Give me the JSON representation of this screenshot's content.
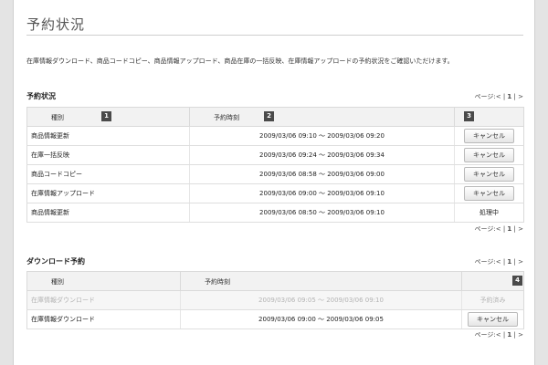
{
  "page": {
    "title": "予約状況",
    "intro": "在庫情報ダウンロード、商品コードコピー、商品情報アップロード、商品在庫の一括反映、在庫情報アップロードの予約状況をご確認いただけます。"
  },
  "reservations": {
    "title": "予約状況",
    "pager_top": {
      "label": "ページ:",
      "prev": "<",
      "current": "1",
      "next": ">"
    },
    "pager_bottom": {
      "label": "ページ:",
      "prev": "<",
      "current": "1",
      "next": ">"
    },
    "columns": {
      "type": "種別",
      "time": "予約時刻",
      "action": ""
    },
    "badges": {
      "b1": "1",
      "b2": "2",
      "b3": "3"
    },
    "rows": [
      {
        "type": "商品情報更新",
        "time": "2009/03/06 09:10 〜 2009/03/06 09:20",
        "action": "キャンセル"
      },
      {
        "type": "在庫一括反映",
        "time": "2009/03/06 09:24 〜 2009/03/06 09:34",
        "action": "キャンセル"
      },
      {
        "type": "商品コードコピー",
        "time": "2009/03/06 08:58 〜 2009/03/06 09:00",
        "action": "キャンセル"
      },
      {
        "type": "在庫情報アップロード",
        "time": "2009/03/06 09:00 〜 2009/03/06 09:10",
        "action": "キャンセル"
      },
      {
        "type": "商品情報更新",
        "time": "2009/03/06 08:50 〜 2009/03/06 09:10",
        "status": "処理中"
      }
    ]
  },
  "downloads": {
    "title": "ダウンロード予約",
    "pager_top": {
      "label": "ページ:",
      "prev": "<",
      "current": "1",
      "next": ">"
    },
    "pager_bottom": {
      "label": "ページ:",
      "prev": "<",
      "current": "1",
      "next": ">"
    },
    "columns": {
      "type": "種別",
      "time": "予約時刻",
      "action": ""
    },
    "badges": {
      "b4": "4"
    },
    "rows": [
      {
        "type": "在庫情報ダウンロード",
        "time": "2009/03/06 09:05 〜 2009/03/06 09:10",
        "status": "予約済み"
      },
      {
        "type": "在庫情報ダウンロード",
        "time": "2009/03/06 09:00 〜 2009/03/06 09:05",
        "action": "キャンセル"
      }
    ]
  },
  "colors": {
    "background": "#e4e4e4",
    "panel": "#ffffff",
    "header_bg": "#f2f2f2",
    "badge_bg": "#4a4a4a",
    "faded_text": "#b4b4b4"
  }
}
